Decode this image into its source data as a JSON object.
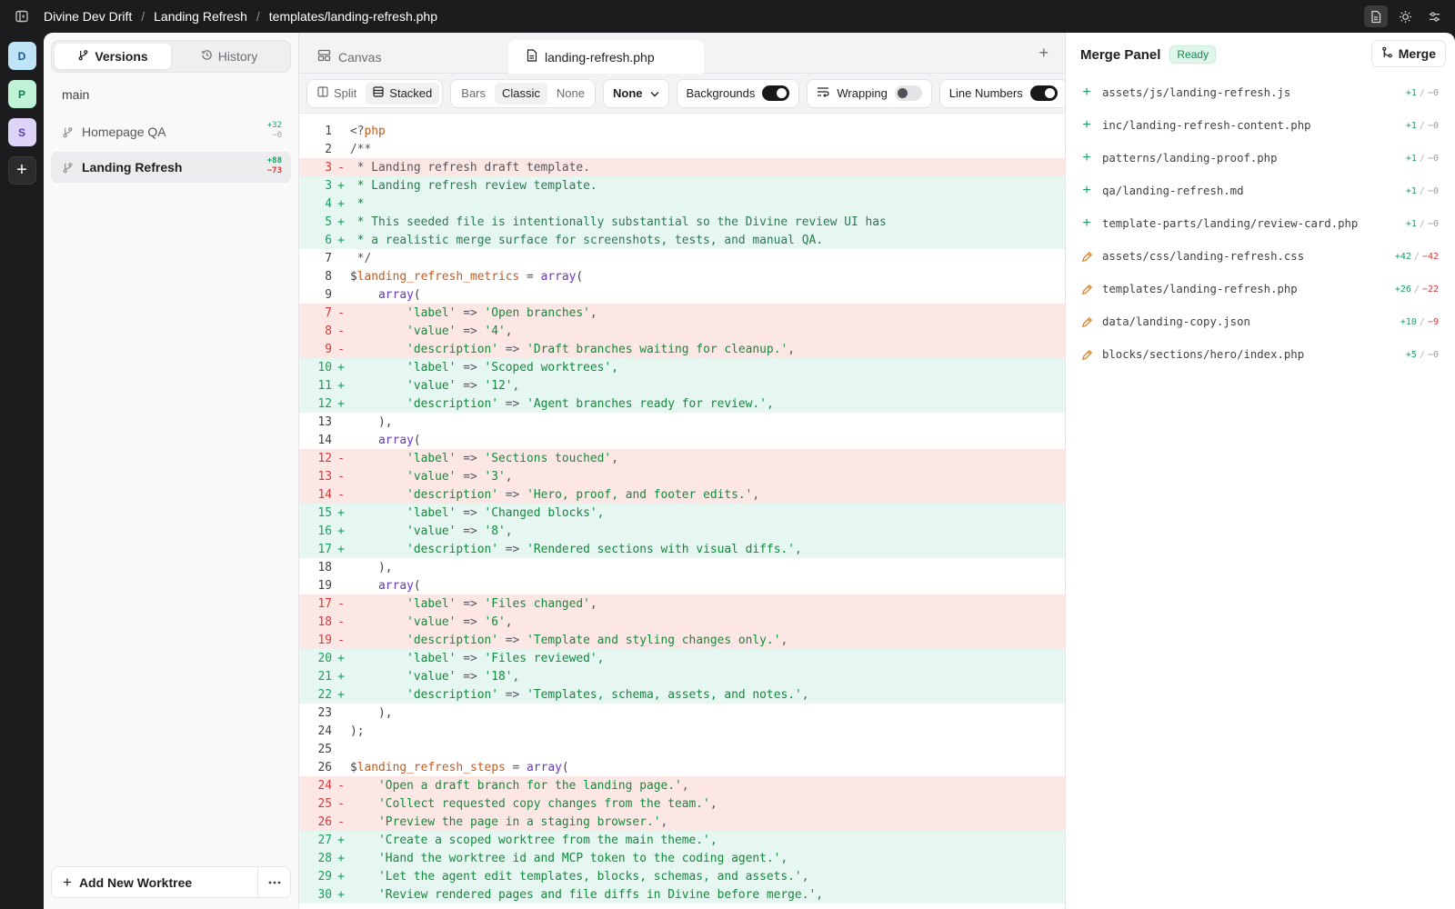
{
  "topbar": {
    "crumbs": [
      "Divine Dev Drift",
      "Landing Refresh",
      "templates/landing-refresh.php"
    ],
    "separator": "/"
  },
  "rail": {
    "avatars": [
      "D",
      "P",
      "S"
    ],
    "add": "+"
  },
  "sidebar": {
    "tabs": [
      {
        "label": "Versions"
      },
      {
        "label": "History"
      }
    ],
    "base_branch": "main",
    "worktrees": [
      {
        "label": "Homepage QA",
        "plus": "+32",
        "minus": "−0"
      },
      {
        "label": "Landing Refresh",
        "plus": "+88",
        "minus": "−73"
      }
    ],
    "add_label": "Add New Worktree"
  },
  "editor": {
    "tabs": [
      {
        "label": "Canvas"
      },
      {
        "label": "landing-refresh.php"
      }
    ],
    "toolbar": {
      "layout": [
        "Split",
        "Stacked"
      ],
      "style": [
        "Bars",
        "Classic",
        "None"
      ],
      "dropdown": "None",
      "backgrounds": "Backgrounds",
      "wrapping": "Wrapping",
      "line_numbers": "Line Numbers"
    },
    "lines": [
      {
        "n": "1",
        "t": "ctx",
        "h": "<span class='op'>&lt;?</span><span class='var'>php</span>"
      },
      {
        "n": "2",
        "t": "ctx",
        "h": "<span class='cm'>/**</span>"
      },
      {
        "n": "3",
        "t": "del",
        "h": " * Landing refresh draft template."
      },
      {
        "n": "3",
        "t": "add",
        "h": " * Landing refresh review template."
      },
      {
        "n": "4",
        "t": "add",
        "h": " *"
      },
      {
        "n": "5",
        "t": "add",
        "h": " * This seeded file is intentionally substantial so the Divine review UI has"
      },
      {
        "n": "6",
        "t": "add",
        "h": " * a realistic merge surface for screenshots, tests, and manual QA."
      },
      {
        "n": "7",
        "t": "ctx",
        "h": "<span class='cm'> */</span>"
      },
      {
        "n": "8",
        "t": "ctx",
        "h": "$<span class='var'>landing_refresh_metrics</span> <span class='op'>=</span> <span class='kw'>array</span>("
      },
      {
        "n": "9",
        "t": "ctx",
        "h": "    <span class='kw'>array</span>("
      },
      {
        "n": "7",
        "t": "del",
        "h": "        <span class='str'>'label'</span> <span class='op'>=&gt;</span> <span class='str'>'Open branches'</span>,"
      },
      {
        "n": "8",
        "t": "del",
        "h": "        <span class='str'>'value'</span> <span class='op'>=&gt;</span> <span class='str'>'4'</span>,"
      },
      {
        "n": "9",
        "t": "del",
        "h": "        <span class='str'>'description'</span> <span class='op'>=&gt;</span> <span class='str'>'Draft branches waiting for cleanup.'</span>,"
      },
      {
        "n": "10",
        "t": "add",
        "h": "        <span class='str'>'label'</span> <span class='op'>=&gt;</span> <span class='str'>'Scoped worktrees'</span>,"
      },
      {
        "n": "11",
        "t": "add",
        "h": "        <span class='str'>'value'</span> <span class='op'>=&gt;</span> <span class='str'>'12'</span>,"
      },
      {
        "n": "12",
        "t": "add",
        "h": "        <span class='str'>'description'</span> <span class='op'>=&gt;</span> <span class='str'>'Agent branches ready for review.'</span>,"
      },
      {
        "n": "13",
        "t": "ctx",
        "h": "    ),"
      },
      {
        "n": "14",
        "t": "ctx",
        "h": "    <span class='kw'>array</span>("
      },
      {
        "n": "12",
        "t": "del",
        "h": "        <span class='str'>'label'</span> <span class='op'>=&gt;</span> <span class='str'>'Sections touched'</span>,"
      },
      {
        "n": "13",
        "t": "del",
        "h": "        <span class='str'>'value'</span> <span class='op'>=&gt;</span> <span class='str'>'3'</span>,"
      },
      {
        "n": "14",
        "t": "del",
        "h": "        <span class='str'>'description'</span> <span class='op'>=&gt;</span> <span class='str'>'Hero, proof, and footer edits.'</span>,"
      },
      {
        "n": "15",
        "t": "add",
        "h": "        <span class='str'>'label'</span> <span class='op'>=&gt;</span> <span class='str'>'Changed blocks'</span>,"
      },
      {
        "n": "16",
        "t": "add",
        "h": "        <span class='str'>'value'</span> <span class='op'>=&gt;</span> <span class='str'>'8'</span>,"
      },
      {
        "n": "17",
        "t": "add",
        "h": "        <span class='str'>'description'</span> <span class='op'>=&gt;</span> <span class='str'>'Rendered sections with visual diffs.'</span>,"
      },
      {
        "n": "18",
        "t": "ctx",
        "h": "    ),"
      },
      {
        "n": "19",
        "t": "ctx",
        "h": "    <span class='kw'>array</span>("
      },
      {
        "n": "17",
        "t": "del",
        "h": "        <span class='str'>'label'</span> <span class='op'>=&gt;</span> <span class='str'>'Files changed'</span>,"
      },
      {
        "n": "18",
        "t": "del",
        "h": "        <span class='str'>'value'</span> <span class='op'>=&gt;</span> <span class='str'>'6'</span>,"
      },
      {
        "n": "19",
        "t": "del",
        "h": "        <span class='str'>'description'</span> <span class='op'>=&gt;</span> <span class='str'>'Template and styling changes only.'</span>,"
      },
      {
        "n": "20",
        "t": "add",
        "h": "        <span class='str'>'label'</span> <span class='op'>=&gt;</span> <span class='str'>'Files reviewed'</span>,"
      },
      {
        "n": "21",
        "t": "add",
        "h": "        <span class='str'>'value'</span> <span class='op'>=&gt;</span> <span class='str'>'18'</span>,"
      },
      {
        "n": "22",
        "t": "add",
        "h": "        <span class='str'>'description'</span> <span class='op'>=&gt;</span> <span class='str'>'Templates, schema, assets, and notes.'</span>,"
      },
      {
        "n": "23",
        "t": "ctx",
        "h": "    ),"
      },
      {
        "n": "24",
        "t": "ctx",
        "h": ");"
      },
      {
        "n": "25",
        "t": "ctx",
        "h": ""
      },
      {
        "n": "26",
        "t": "ctx",
        "h": "$<span class='var'>landing_refresh_steps</span> <span class='op'>=</span> <span class='kw'>array</span>("
      },
      {
        "n": "24",
        "t": "del",
        "h": "    <span class='str'>'Open a draft branch for the landing page.'</span>,"
      },
      {
        "n": "25",
        "t": "del",
        "h": "    <span class='str'>'Collect requested copy changes from the team.'</span>,"
      },
      {
        "n": "26",
        "t": "del",
        "h": "    <span class='str'>'Preview the page in a staging browser.'</span>,"
      },
      {
        "n": "27",
        "t": "add",
        "h": "    <span class='str'>'Create a scoped worktree from the main theme.'</span>,"
      },
      {
        "n": "28",
        "t": "add",
        "h": "    <span class='str'>'Hand the worktree id and MCP token to the coding agent.'</span>,"
      },
      {
        "n": "29",
        "t": "add",
        "h": "    <span class='str'>'Let the agent edit templates, blocks, schemas, and assets.'</span>,"
      },
      {
        "n": "30",
        "t": "add",
        "h": "    <span class='str'>'Review rendered pages and file diffs in Divine before merge.'</span>,"
      }
    ]
  },
  "merge_panel": {
    "title": "Merge Panel",
    "status": "Ready",
    "merge_label": "Merge",
    "files": [
      {
        "path": "assets/js/landing-refresh.js",
        "kind": "added",
        "plus": "+1",
        "minus": "−0"
      },
      {
        "path": "inc/landing-refresh-content.php",
        "kind": "added",
        "plus": "+1",
        "minus": "−0"
      },
      {
        "path": "patterns/landing-proof.php",
        "kind": "added",
        "plus": "+1",
        "minus": "−0"
      },
      {
        "path": "qa/landing-refresh.md",
        "kind": "added",
        "plus": "+1",
        "minus": "−0"
      },
      {
        "path": "template-parts/landing/review-card.php",
        "kind": "added",
        "plus": "+1",
        "minus": "−0"
      },
      {
        "path": "assets/css/landing-refresh.css",
        "kind": "modified",
        "plus": "+42",
        "minus": "−42"
      },
      {
        "path": "templates/landing-refresh.php",
        "kind": "modified",
        "plus": "+26",
        "minus": "−22"
      },
      {
        "path": "data/landing-copy.json",
        "kind": "modified",
        "plus": "+10",
        "minus": "−9"
      },
      {
        "path": "blocks/sections/hero/index.php",
        "kind": "modified",
        "plus": "+5",
        "minus": "−0"
      }
    ],
    "colors": {
      "plus": "#1a9e5f",
      "minus": "#d33a3a",
      "modified_icon": "#d9822b"
    }
  }
}
